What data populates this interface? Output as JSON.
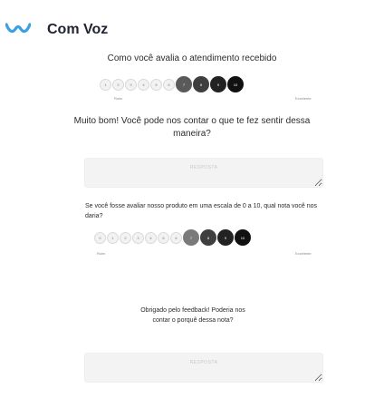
{
  "header": {
    "brand": "Com Voz",
    "logo_icon": "com-voz-logo-icon",
    "accent": "#3aa0e6"
  },
  "q1": {
    "question": "Como você avalia o atendimento recebido",
    "scale": [
      "1",
      "2",
      "3",
      "4",
      "5",
      "6",
      "7",
      "8",
      "9",
      "10"
    ],
    "low_label": "Ruim",
    "high_label": "Excelente"
  },
  "q2": {
    "question": "Muito bom! Você pode nos contar o que te fez sentir dessa maneira?",
    "placeholder": "RESPOSTA"
  },
  "q3": {
    "question": "Se você fosse avaliar nosso produto em uma escala de 0 a 10, qual nota você nos daria?",
    "scale": [
      "0",
      "1",
      "2",
      "3",
      "4",
      "5",
      "6",
      "7",
      "8",
      "9",
      "10"
    ],
    "low_label": "Ruim",
    "high_label": "Excelente"
  },
  "q4": {
    "question": "Obrigado pelo feedback! Poderia nos contar o porquê dessa nota?",
    "placeholder": "RESPOSTA"
  }
}
